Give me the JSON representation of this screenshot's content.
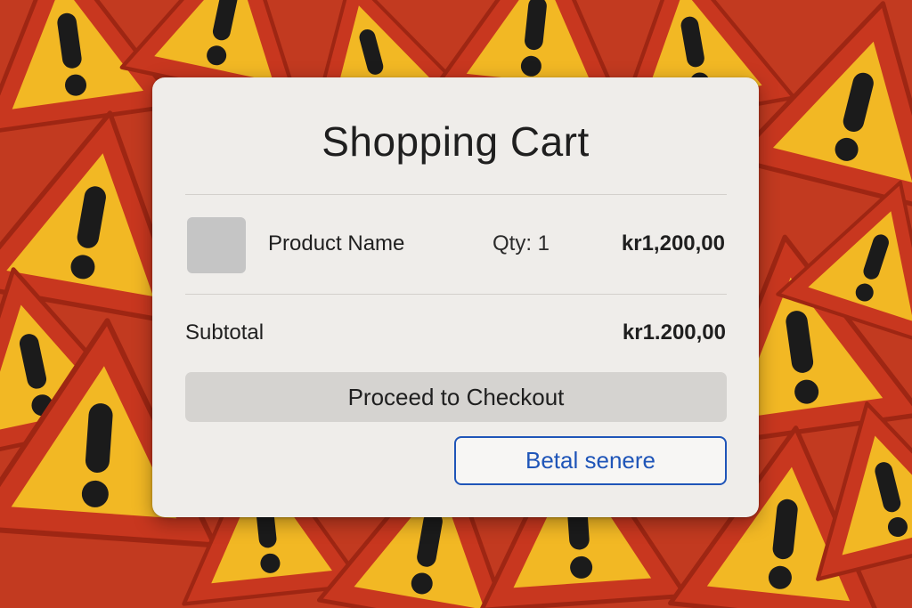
{
  "background": {
    "description_icon": "warning-sign-icon",
    "colors": {
      "sign_red": "#c8371f",
      "sign_yellow": "#f2b824",
      "mark_black": "#1b1b1b"
    }
  },
  "cart": {
    "title": "Shopping Cart",
    "items": [
      {
        "name": "Product Name",
        "qty": "Qty: 1",
        "price": "kr1,200,00",
        "thumbnail_icon": "product-thumbnail"
      }
    ],
    "subtotal_label": "Subtotal",
    "subtotal_value": "kr1.200,00",
    "checkout_label": "Proceed to Checkout",
    "pay_later_label": "Betal senere"
  },
  "colors": {
    "card_bg": "#efedea",
    "checkout_bg": "#d5d3d0",
    "accent_blue": "#1f55b8"
  }
}
